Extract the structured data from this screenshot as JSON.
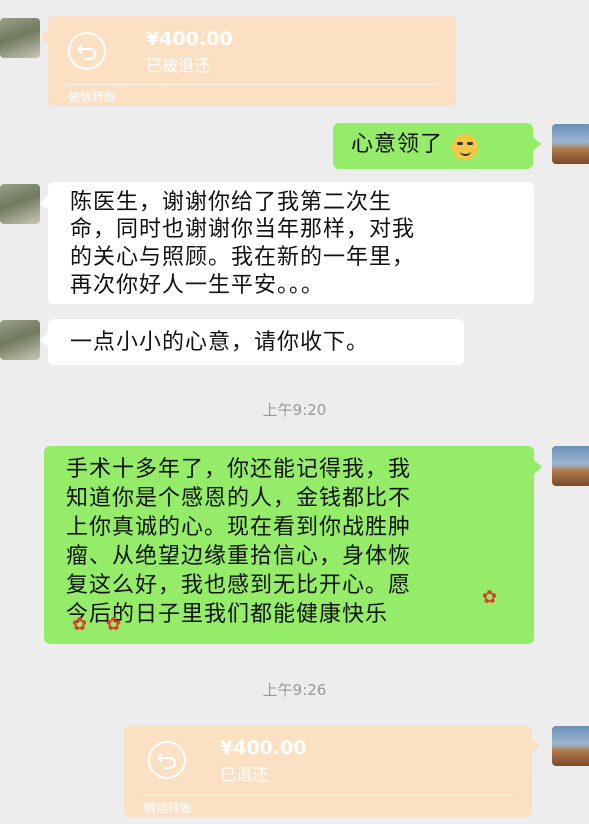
{
  "messages": {
    "transfer_in": {
      "amount": "¥400.00",
      "status": "已被退还",
      "footer": "微信转账"
    },
    "reply_1": {
      "text": "心意领了",
      "emoji": "smirk-emoji"
    },
    "msg_1": {
      "lines": [
        "陈医生，谢谢你给了我第二次生",
        "命，同时也谢谢你当年那样，对我",
        "的关心与照顾。我在新的一年里，",
        "再次你好人一生平安。。。"
      ]
    },
    "msg_2": {
      "text": "一点小小的心意，请你收下。"
    },
    "time_1": "上午9:20",
    "reply_2": {
      "lines": [
        "手术十多年了，你还能记得我，我",
        "知道你是个感恩的人，金钱都比不",
        "上你真诚的心。现在看到你战胜肿",
        "瘤、从绝望边缘重拾信心，身体恢",
        "复这么好，我也感到无比开心。愿",
        "今后的日子里我们都能健康快乐"
      ],
      "emoji": "rose-emoji"
    },
    "time_2": "上午9:26",
    "transfer_out": {
      "amount": "¥400.00",
      "status": "已退还",
      "footer": "微信转账"
    }
  },
  "colors": {
    "bg": "#ededed",
    "green": "#95ec69",
    "transfer": "#fbe0c3"
  }
}
